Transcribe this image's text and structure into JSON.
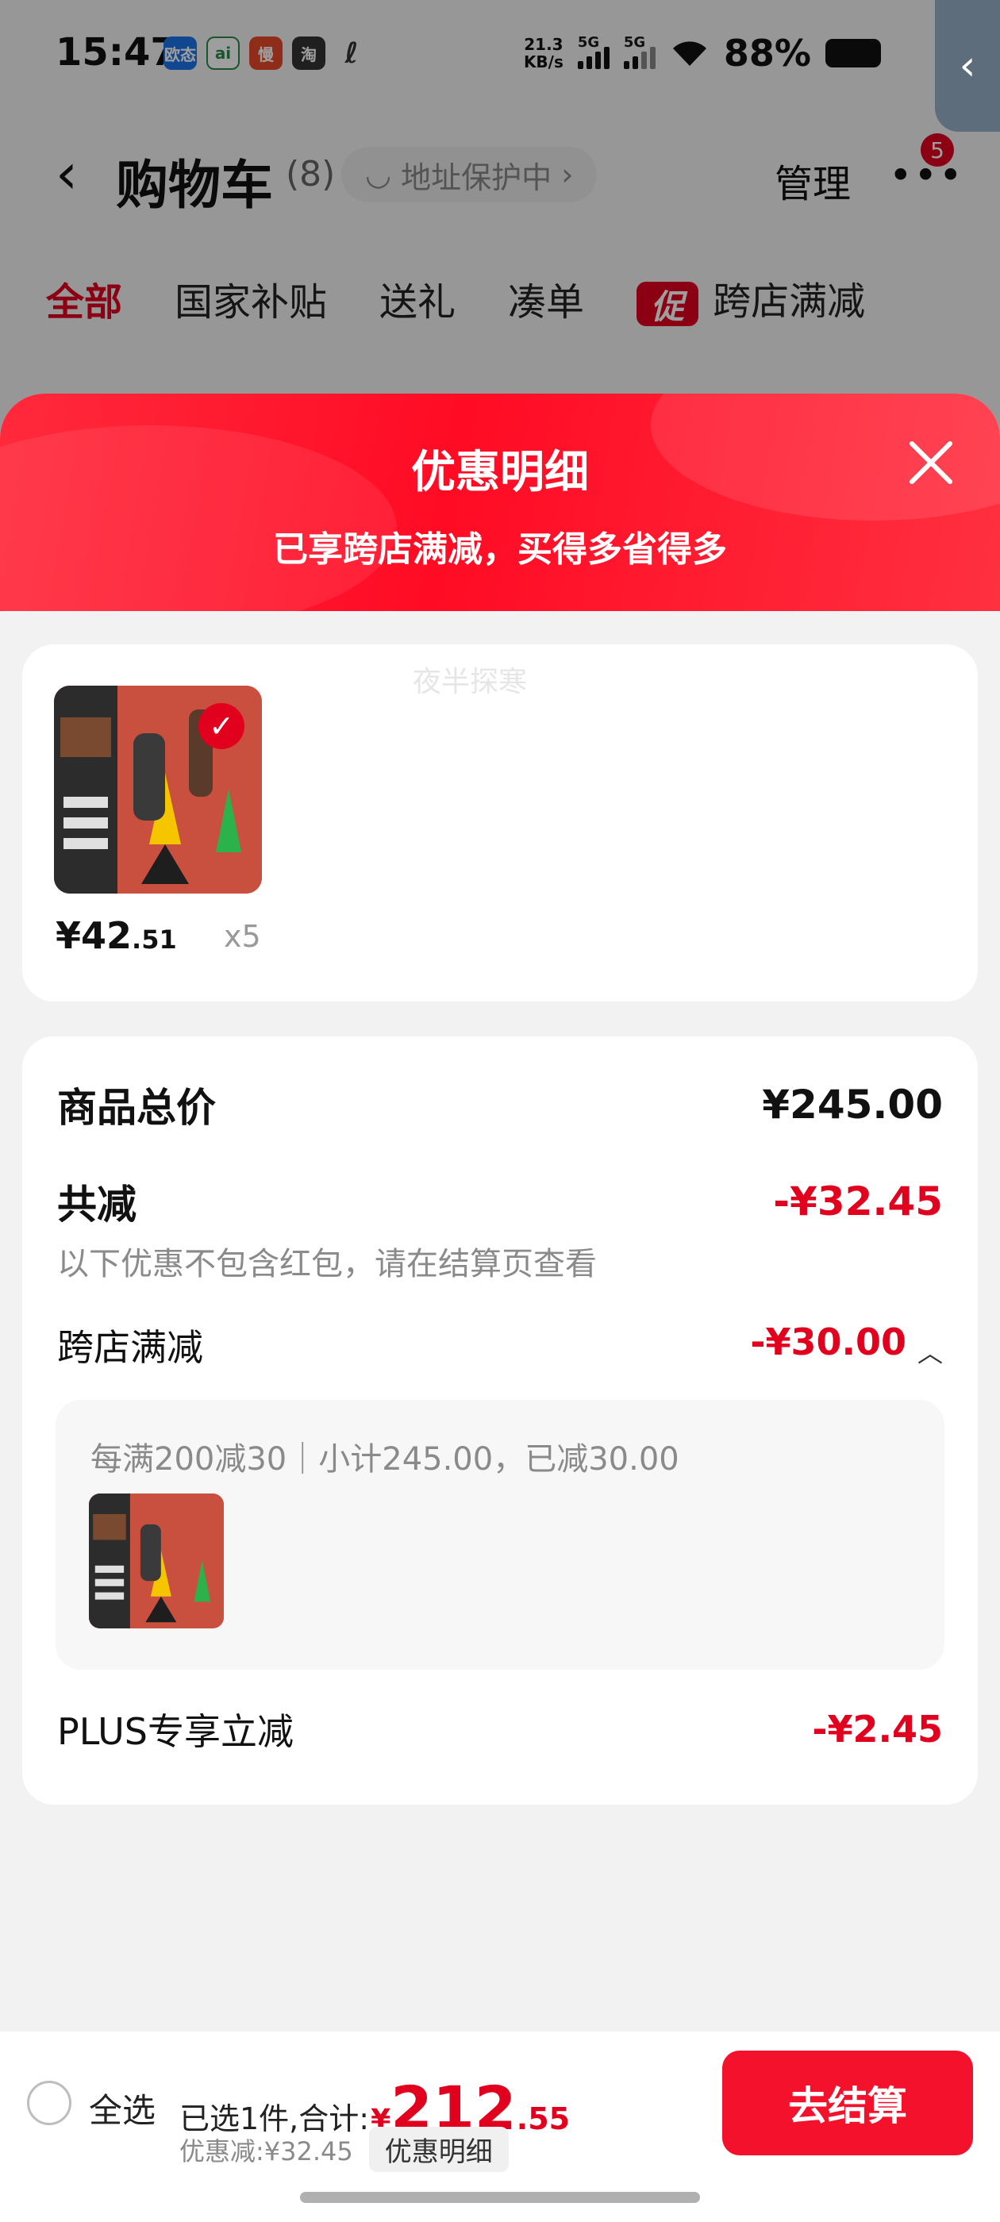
{
  "status_bar": {
    "time": "15:47",
    "apps": [
      {
        "label": "欧态",
        "color": "#1a73e8"
      },
      {
        "label": "ai",
        "color": "#ffffff"
      },
      {
        "label": "慢",
        "color": "#e84a2a"
      },
      {
        "label": "淘",
        "color": "#333333"
      },
      {
        "label": "ℓ",
        "color": "#333333"
      }
    ],
    "net_speed": "21.3",
    "net_unit": "KB/s",
    "signal1": "5G",
    "signal2": "5G",
    "battery": "88%"
  },
  "nav": {
    "title": "购物车",
    "count": "(8)",
    "address": "地址保护中",
    "manage": "管理",
    "badge": "5"
  },
  "tabs": [
    "全部",
    "国家补贴",
    "送礼",
    "凑单",
    "跨店满减"
  ],
  "promo_tag": "促",
  "sheet": {
    "title": "优惠明细",
    "subtitle": "已享跨店满减，买得多省得多"
  },
  "item": {
    "price_int": "¥42",
    "price_dec": ".51",
    "qty": "x5"
  },
  "watermark": "夜半探寒",
  "breakdown": {
    "total_label": "商品总价",
    "total_value": "¥245.00",
    "reduce_label": "共减",
    "reduce_value": "-¥32.45",
    "note": "以下优惠不包含红包，请在结算页查看",
    "cross_label": "跨店满减",
    "cross_value": "-¥30.00",
    "cross_detail": "每满200减30｜小计245.00，已减30.00",
    "plus_label": "PLUS专享立减",
    "plus_value": "-¥2.45"
  },
  "bottom": {
    "select_all": "全选",
    "selected": "已选1件,合计:",
    "total_symbol": "¥",
    "total_int": "212",
    "total_dec": ".55",
    "discount": "优惠减:¥32.45",
    "detail_btn": "优惠明细",
    "checkout": "去结算"
  }
}
